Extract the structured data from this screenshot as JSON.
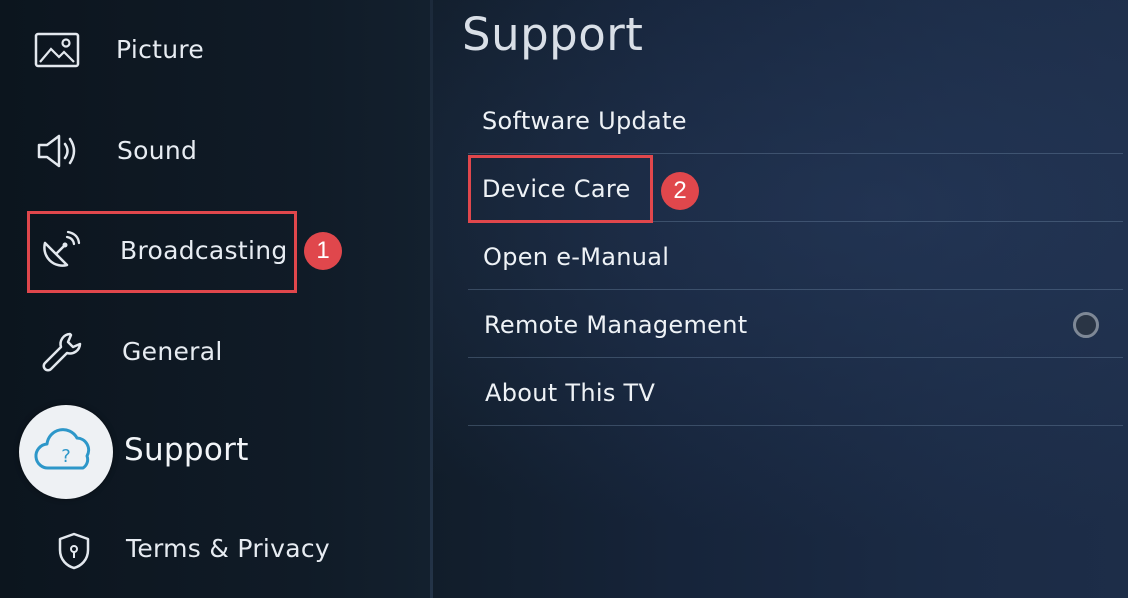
{
  "left_menu": {
    "items": [
      {
        "key": "picture",
        "label": "Picture",
        "icon": "picture-icon"
      },
      {
        "key": "sound",
        "label": "Sound",
        "icon": "speaker-icon"
      },
      {
        "key": "broadcasting",
        "label": "Broadcasting",
        "icon": "satellite-dish-icon"
      },
      {
        "key": "general",
        "label": "General",
        "icon": "wrench-icon"
      },
      {
        "key": "support",
        "label": "Support",
        "icon": "cloud-question-icon"
      },
      {
        "key": "terms",
        "label": "Terms & Privacy",
        "icon": "shield-icon"
      }
    ]
  },
  "right_panel": {
    "title": "Support",
    "items": [
      {
        "key": "software_update",
        "label": "Software Update"
      },
      {
        "key": "device_care",
        "label": "Device Care"
      },
      {
        "key": "open_manual",
        "label": "Open e-Manual"
      },
      {
        "key": "remote_management",
        "label": "Remote Management",
        "toggle": "off"
      },
      {
        "key": "about_tv",
        "label": "About This TV"
      }
    ]
  },
  "annotations": {
    "step1": "1",
    "step2": "2",
    "color": "#e0474c"
  },
  "colors": {
    "background_left": "#0c151e",
    "background_right": "#1b2b45",
    "text": "#e7ecf2",
    "support_disc": "#eef1f4",
    "support_icon": "#2d97c9"
  }
}
